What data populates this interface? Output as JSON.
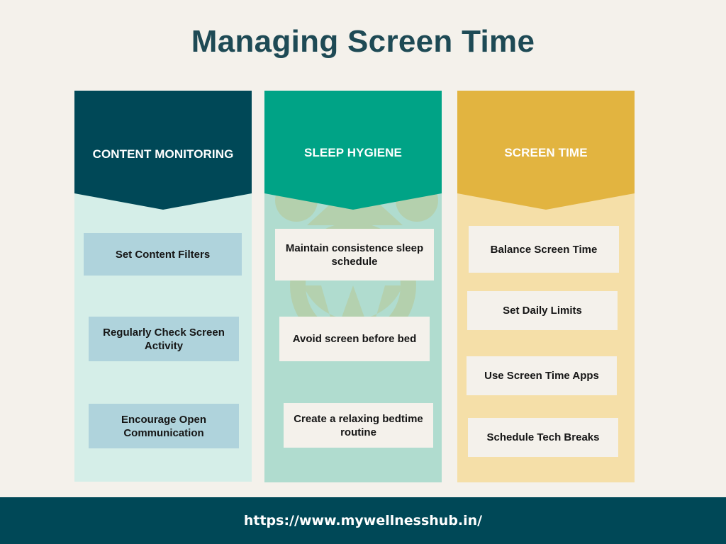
{
  "title": "Managing Screen Time",
  "columns": [
    {
      "heading": "CONTENT MONITORING",
      "header_color": "#004857",
      "body_color": "#d5eee8",
      "card_color": "#afd3dc",
      "items": [
        "Set Content Filters",
        "Regularly Check Screen Activity",
        "Encourage Open Communication"
      ]
    },
    {
      "heading": "SLEEP HYGIENE",
      "header_color": "#00a386",
      "body_color": "#b0dccf",
      "card_color": "#f4f1eb",
      "watermark_icon": "wordpress-logo-icon",
      "items": [
        "Maintain consistence sleep schedule",
        "Avoid screen before bed",
        "Create a relaxing bedtime routine"
      ]
    },
    {
      "heading": "SCREEN TIME",
      "header_color": "#e2b440",
      "body_color": "#f5dfa8",
      "card_color": "#f4f1eb",
      "items": [
        "Balance Screen Time",
        "Set Daily Limits",
        "Use Screen Time Apps",
        "Schedule Tech Breaks"
      ]
    }
  ],
  "footer": {
    "url": "https://www.mywellnesshub.in/",
    "background": "#004857"
  }
}
